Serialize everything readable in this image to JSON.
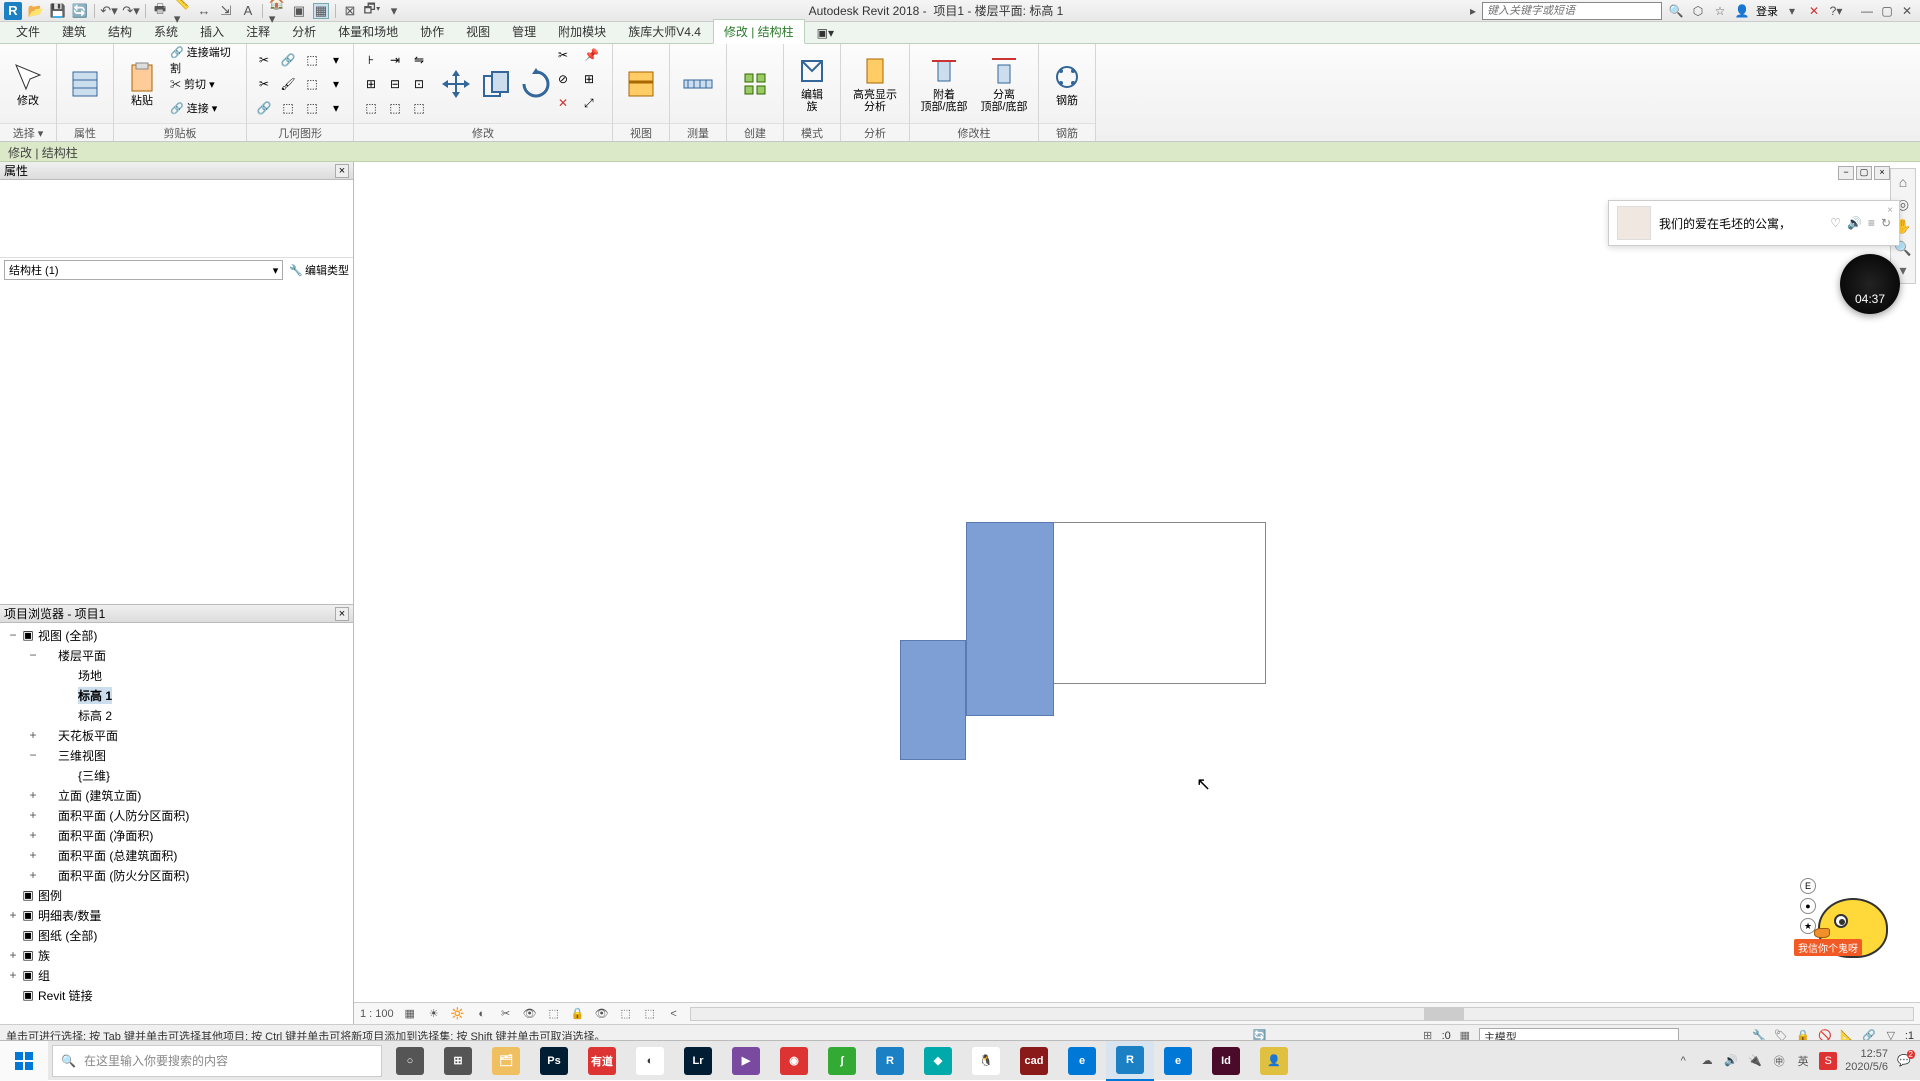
{
  "app": {
    "title": "Autodesk Revit 2018 -",
    "document": "项目1 - 楼层平面: 标高 1",
    "search_placeholder": "键入关键字或短语",
    "login": "登录"
  },
  "qat": [
    "open",
    "save",
    "sync",
    "undo",
    "redo",
    "print",
    "measure",
    "thin",
    "switch",
    "text",
    "3d",
    "close",
    "section",
    "sheet",
    "add"
  ],
  "menu_tabs": [
    {
      "label": "文件",
      "active": false
    },
    {
      "label": "建筑",
      "active": false
    },
    {
      "label": "结构",
      "active": false
    },
    {
      "label": "系统",
      "active": false
    },
    {
      "label": "插入",
      "active": false
    },
    {
      "label": "注释",
      "active": false
    },
    {
      "label": "分析",
      "active": false
    },
    {
      "label": "体量和场地",
      "active": false
    },
    {
      "label": "协作",
      "active": false
    },
    {
      "label": "视图",
      "active": false
    },
    {
      "label": "管理",
      "active": false
    },
    {
      "label": "附加模块",
      "active": false
    },
    {
      "label": "族库大师V4.4",
      "active": false
    },
    {
      "label": "修改 | 结构柱",
      "active": true,
      "green": true
    }
  ],
  "ribbon_groups": [
    {
      "label": "选择 ▾",
      "buttons": [
        {
          "t": "修改",
          "big": true
        }
      ]
    },
    {
      "label": "属性",
      "buttons": [
        {
          "t": "",
          "big": true
        }
      ]
    },
    {
      "label": "剪贴板",
      "buttons": [
        {
          "t": "粘贴",
          "big": true
        }
      ],
      "rows": [
        {
          "t": "✂ 剪切 ▾"
        },
        {
          "t": "🔗 连接端切割"
        },
        {
          "t": "✂ 剪切 ▾"
        },
        {
          "t": "🔗 连接 ▾"
        }
      ]
    },
    {
      "label": "几何图形",
      "grid": true,
      "cols": 4
    },
    {
      "label": "修改",
      "grid": true,
      "cols": 4,
      "rows2": true,
      "buttons_big": [
        {
          "t": "↔"
        },
        {
          "t": "↻"
        },
        {
          "t": "✂"
        },
        {
          "t": "✕"
        },
        {
          "t": "⌫"
        }
      ]
    },
    {
      "label": "视图",
      "buttons": [
        {
          "t": "",
          "big": true
        }
      ]
    },
    {
      "label": "测量",
      "buttons": [
        {
          "t": "",
          "big": true
        }
      ]
    },
    {
      "label": "创建",
      "buttons": [
        {
          "t": "",
          "big": true
        }
      ]
    },
    {
      "label": "模式",
      "buttons": [
        {
          "t": "编辑\n族",
          "big": true
        }
      ]
    },
    {
      "label": "分析",
      "buttons": [
        {
          "t": "高亮显示\n分析",
          "big": true
        }
      ]
    },
    {
      "label": "修改柱",
      "buttons": [
        {
          "t": "附着\n顶部/底部",
          "big": true
        },
        {
          "t": "分离\n顶部/底部",
          "big": true
        }
      ]
    },
    {
      "label": "钢筋",
      "buttons": [
        {
          "t": "钢筋",
          "big": true
        }
      ]
    }
  ],
  "context_bar": "修改 | 结构柱",
  "properties": {
    "title": "属性",
    "selector": "结构柱 (1)",
    "edit_type": "编辑类型"
  },
  "browser": {
    "title": "项目浏览器 - 项目1",
    "tree": [
      {
        "lvl": 0,
        "exp": "−",
        "icon": "views",
        "txt": "视图 (全部)"
      },
      {
        "lvl": 1,
        "exp": "−",
        "txt": "楼层平面"
      },
      {
        "lvl": 2,
        "txt": "场地"
      },
      {
        "lvl": 2,
        "txt": "标高 1",
        "sel": true
      },
      {
        "lvl": 2,
        "txt": "标高 2"
      },
      {
        "lvl": 1,
        "exp": "+",
        "txt": "天花板平面"
      },
      {
        "lvl": 1,
        "exp": "−",
        "txt": "三维视图"
      },
      {
        "lvl": 2,
        "txt": "{三维}"
      },
      {
        "lvl": 1,
        "exp": "+",
        "txt": "立面 (建筑立面)"
      },
      {
        "lvl": 1,
        "exp": "+",
        "txt": "面积平面 (人防分区面积)"
      },
      {
        "lvl": 1,
        "exp": "+",
        "txt": "面积平面 (净面积)"
      },
      {
        "lvl": 1,
        "exp": "+",
        "txt": "面积平面 (总建筑面积)"
      },
      {
        "lvl": 1,
        "exp": "+",
        "txt": "面积平面 (防火分区面积)"
      },
      {
        "lvl": 0,
        "exp": "",
        "icon": "legend",
        "txt": "图例"
      },
      {
        "lvl": 0,
        "exp": "+",
        "icon": "sched",
        "txt": "明细表/数量"
      },
      {
        "lvl": 0,
        "exp": "",
        "icon": "sheet",
        "txt": "图纸 (全部)"
      },
      {
        "lvl": 0,
        "exp": "+",
        "icon": "fam",
        "txt": "族"
      },
      {
        "lvl": 0,
        "exp": "+",
        "icon": "grp",
        "txt": "组"
      },
      {
        "lvl": 0,
        "exp": "",
        "icon": "link",
        "txt": "Revit 链接"
      }
    ]
  },
  "view_controls": {
    "scale": "1 : 100",
    "icons": [
      "📦",
      "☀",
      "🔆",
      "✂",
      "👁",
      "⬚",
      "◉",
      "🔒",
      "👁",
      "⬚",
      "⬚",
      "<"
    ]
  },
  "status": {
    "hint": "单击可进行选择; 按 Tab 键并单击可选择其他项目; 按 Ctrl 键并单击可将新项目添加到选择集; 按 Shift 键并单击可取消选择。",
    "coord": ":0",
    "workset": "主模型",
    "right_icons": [
      "🔧",
      "🏷",
      "🔒",
      "🚫",
      "📐",
      "🔗",
      "▽",
      ":1"
    ]
  },
  "now_playing": {
    "text": "我们的爱在毛坯的公寓，",
    "icons": [
      "♡",
      "🔊",
      "≡",
      "↻"
    ]
  },
  "timer": "04:37",
  "duck_banner": "我信你个鬼呀",
  "duck_controls": [
    "E",
    "●",
    "★"
  ],
  "taskbar": {
    "search_placeholder": "在这里输入你要搜索的内容",
    "apps": [
      {
        "name": "cortana",
        "color": "#555",
        "glyph": "○"
      },
      {
        "name": "taskview",
        "color": "#555",
        "glyph": "⊞"
      },
      {
        "name": "explorer",
        "color": "#f0c060",
        "glyph": "🗂"
      },
      {
        "name": "ps",
        "color": "#001d34",
        "glyph": "Ps"
      },
      {
        "name": "youdao",
        "color": "#d33",
        "glyph": "有道"
      },
      {
        "name": "chrome",
        "color": "#fff",
        "glyph": "◐"
      },
      {
        "name": "lr",
        "color": "#001d34",
        "glyph": "Lr"
      },
      {
        "name": "media",
        "color": "#7a4aa0",
        "glyph": "▶"
      },
      {
        "name": "red",
        "color": "#d33",
        "glyph": "◉"
      },
      {
        "name": "green",
        "color": "#3a3",
        "glyph": "ʃ"
      },
      {
        "name": "revit-blue",
        "color": "#1b81c4",
        "glyph": "R"
      },
      {
        "name": "cyan",
        "color": "#0aa",
        "glyph": "◆"
      },
      {
        "name": "qq",
        "color": "#fff",
        "glyph": "🐧"
      },
      {
        "name": "cad",
        "color": "#8a1a1a",
        "glyph": "cad"
      },
      {
        "name": "edge",
        "color": "#0078d7",
        "glyph": "e"
      },
      {
        "name": "revit",
        "color": "#1b81c4",
        "glyph": "R",
        "active": true
      },
      {
        "name": "ie",
        "color": "#0078d7",
        "glyph": "e"
      },
      {
        "name": "id",
        "color": "#4a0a2a",
        "glyph": "Id"
      },
      {
        "name": "app",
        "color": "#e0c040",
        "glyph": "👤"
      }
    ],
    "tray_icons": [
      "^",
      "☁",
      "🔊",
      "🔌"
    ],
    "ime": [
      "㊥",
      "英",
      "S"
    ],
    "time": "12:57",
    "date": "2020/5/6",
    "notif": "💬",
    "notif_count": "2"
  }
}
